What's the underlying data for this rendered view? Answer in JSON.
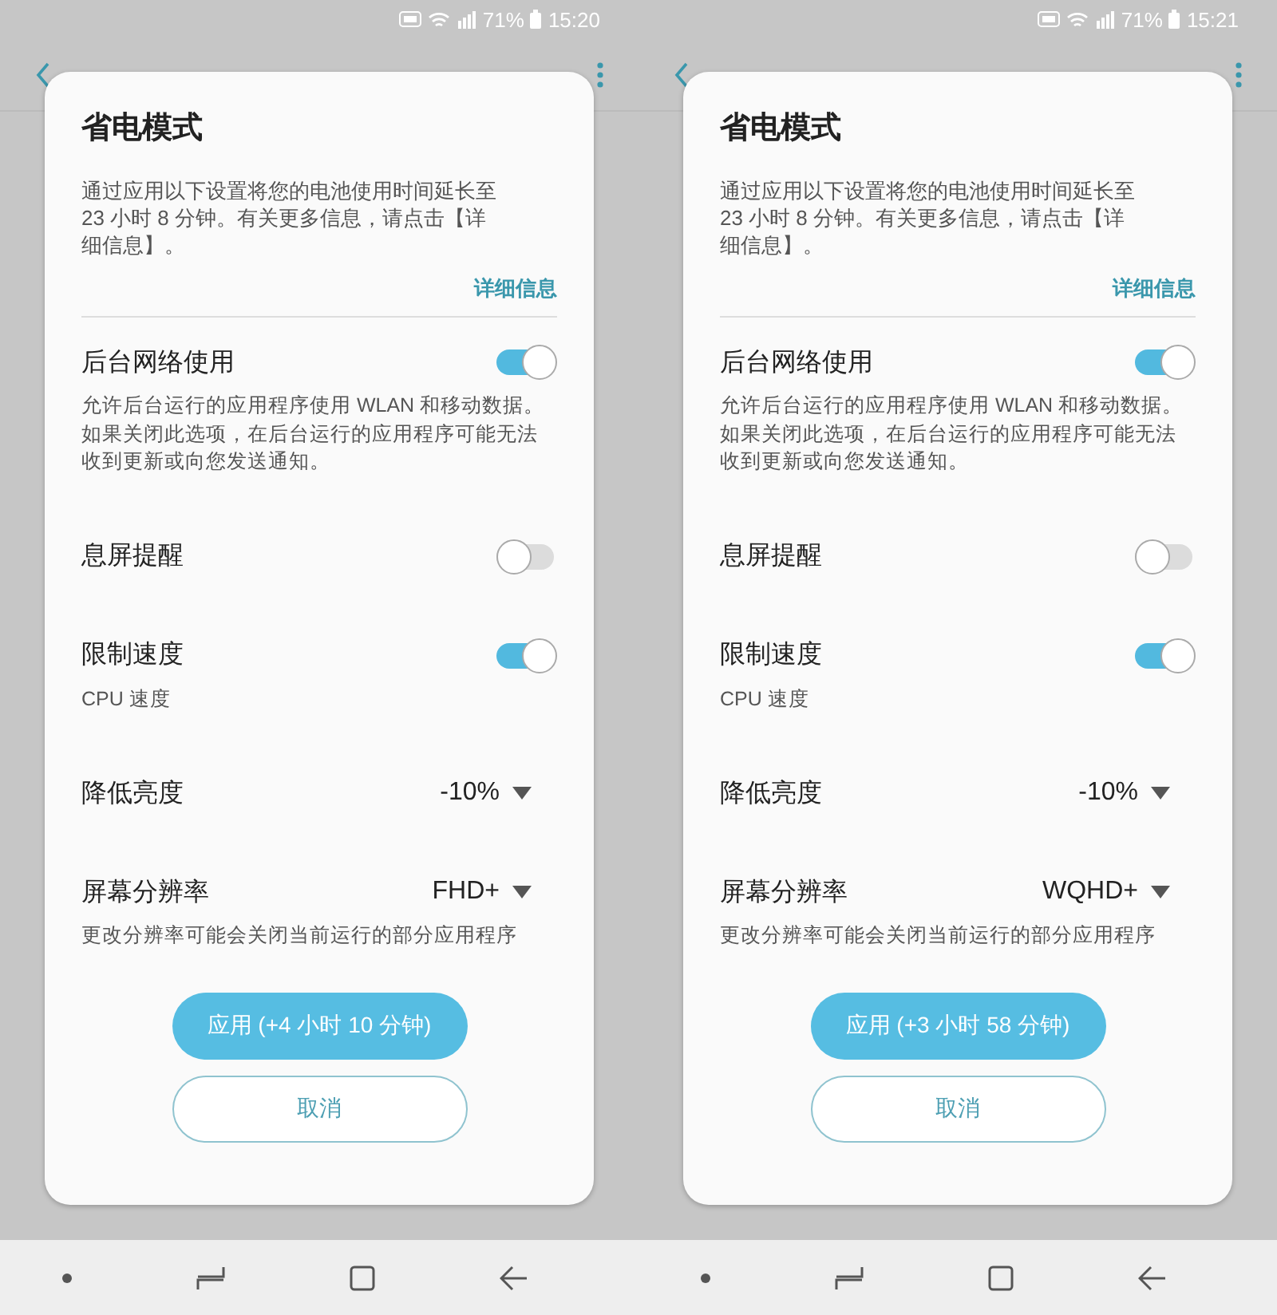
{
  "screens": [
    {
      "status_bar": {
        "battery": "71%",
        "time": "15:20"
      },
      "dialog": {
        "title": "省电模式",
        "description": "通过应用以下设置将您的电池使用时间延长至 23 小时 8 分钟。有关更多信息，请点击【详细信息】。",
        "link": "详细信息",
        "settings": [
          {
            "kind": "toggle",
            "label": "后台网络使用",
            "on": true,
            "description": "允许后台运行的应用程序使用 WLAN 和移动数据。如果关闭此选项，在后台运行的应用程序可能无法收到更新或向您发送通知。"
          },
          {
            "kind": "toggle",
            "label": "息屏提醒",
            "on": false
          },
          {
            "kind": "toggle",
            "label": "限制速度",
            "on": true,
            "description": "CPU 速度"
          },
          {
            "kind": "dropdown",
            "label": "降低亮度",
            "value": "-10%"
          },
          {
            "kind": "dropdown",
            "label": "屏幕分辨率",
            "value": "FHD+",
            "description": "更改分辨率可能会关闭当前运行的部分应用程序"
          }
        ],
        "buttons": [
          {
            "kind": "primary",
            "label": "应用 (+4 小时 10 分钟)"
          },
          {
            "kind": "secondary",
            "label": "取消"
          }
        ]
      }
    },
    {
      "status_bar": {
        "battery": "71%",
        "time": "15:21"
      },
      "dialog": {
        "title": "省电模式",
        "description": "通过应用以下设置将您的电池使用时间延长至 23 小时 8 分钟。有关更多信息，请点击【详细信息】。",
        "link": "详细信息",
        "settings": [
          {
            "kind": "toggle",
            "label": "后台网络使用",
            "on": true,
            "description": "允许后台运行的应用程序使用 WLAN 和移动数据。如果关闭此选项，在后台运行的应用程序可能无法收到更新或向您发送通知。"
          },
          {
            "kind": "toggle",
            "label": "息屏提醒",
            "on": false
          },
          {
            "kind": "toggle",
            "label": "限制速度",
            "on": true,
            "description": "CPU 速度"
          },
          {
            "kind": "dropdown",
            "label": "降低亮度",
            "value": "-10%"
          },
          {
            "kind": "dropdown",
            "label": "屏幕分辨率",
            "value": "WQHD+",
            "description": "更改分辨率可能会关闭当前运行的部分应用程序"
          }
        ],
        "buttons": [
          {
            "kind": "primary",
            "label": "应用 (+3 小时 58 分钟)"
          },
          {
            "kind": "secondary",
            "label": "取消"
          }
        ]
      }
    }
  ]
}
